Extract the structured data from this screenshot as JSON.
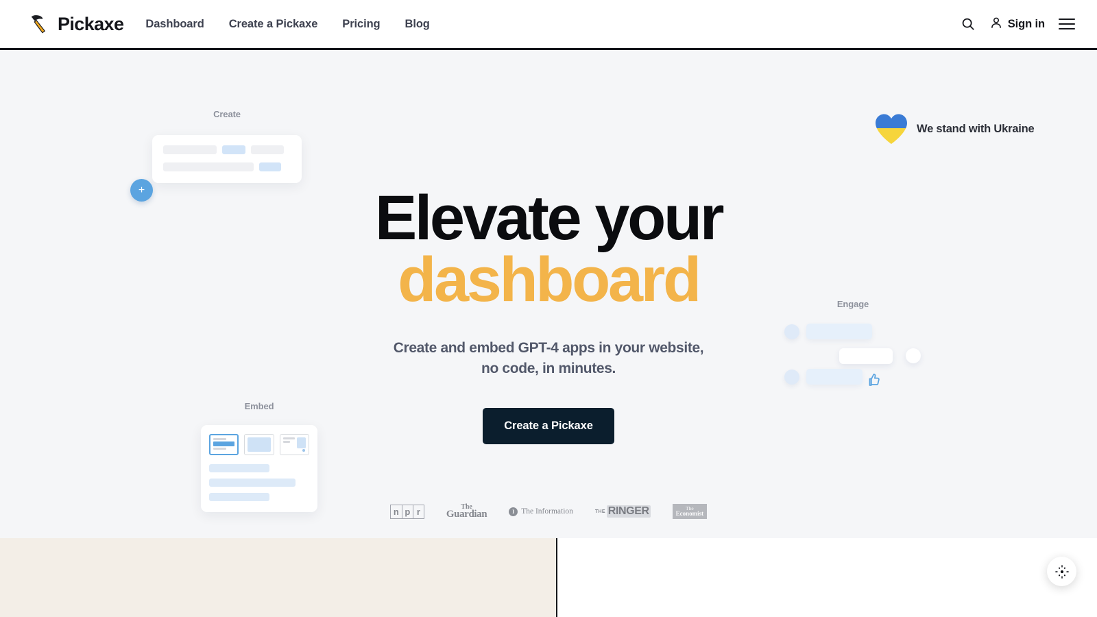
{
  "header": {
    "brand": {
      "name": "Pickaxe",
      "icon": "pickaxe-logo-icon"
    },
    "nav": [
      {
        "label": "Dashboard"
      },
      {
        "label": "Create a Pickaxe"
      },
      {
        "label": "Pricing"
      },
      {
        "label": "Blog"
      }
    ],
    "search_icon": "search-icon",
    "signin_label": "Sign in",
    "signin_icon": "user-icon",
    "menu_icon": "hamburger-menu-icon"
  },
  "banner": {
    "text": "We stand with Ukraine",
    "icon": "ukraine-heart-icon",
    "colors": {
      "blue": "#3a7bd5",
      "yellow": "#f6d53c"
    }
  },
  "hero": {
    "headline_line1": "Elevate your",
    "headline_line2": "dashboard",
    "accent_color": "#f3b44a",
    "subhead": "Create and embed GPT-4 apps in your website, no code, in minutes.",
    "cta_label": "Create a Pickaxe",
    "cta_color": "#0b1e2d",
    "background": "#f5f6f8"
  },
  "mockups": {
    "create": {
      "title": "Create",
      "fab_label": "+",
      "fab_color": "#5ba4e0"
    },
    "embed": {
      "title": "Embed"
    },
    "engage": {
      "title": "Engage",
      "reaction_icon": "thumbs-up-icon"
    }
  },
  "press": [
    {
      "name": "npr",
      "letters": [
        "n",
        "p",
        "r"
      ]
    },
    {
      "name": "the-guardian",
      "line1": "The",
      "line2": "Guardian"
    },
    {
      "name": "the-information",
      "mark": "I",
      "label": "The Information"
    },
    {
      "name": "the-ringer",
      "prefix": "THE",
      "word": "RINGER"
    },
    {
      "name": "the-economist",
      "line1": "The",
      "line2": "Economist"
    }
  ],
  "bottom": {
    "left_color": "#f3eee7",
    "right_color": "#ffffff",
    "fab_icon": "brightness-sparkle-icon"
  }
}
